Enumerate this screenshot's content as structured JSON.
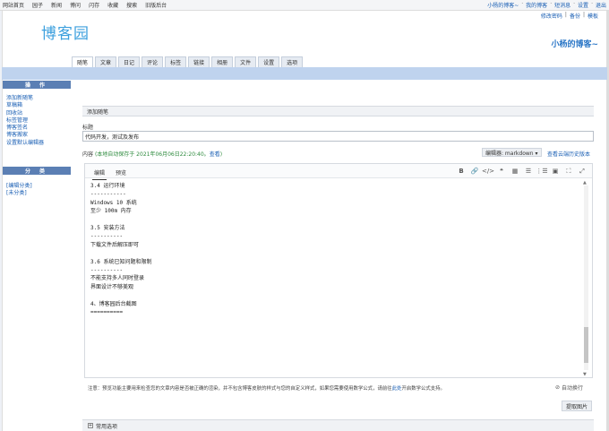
{
  "topnav": {
    "links": [
      "网站首页",
      "园子",
      "新闻",
      "博问",
      "闪存",
      "收藏",
      "搜索",
      "旧版后台"
    ],
    "user": "小杨的博客~",
    "my_blog": "我的博客",
    "messages": "短消息",
    "settings": "设置",
    "logout": "退出"
  },
  "header": {
    "logo": "博客园",
    "change_password": "修改密码",
    "backup": "备份",
    "template": "模板",
    "blog_title": "小杨的博客~"
  },
  "tabs": [
    "随笔",
    "文章",
    "日记",
    "评论",
    "标签",
    "链接",
    "相册",
    "文件",
    "设置",
    "选项"
  ],
  "sidebar": {
    "ops_title": "操 作",
    "ops_items": [
      "添加新随笔",
      "草稿箱",
      "回收站",
      "标签管理",
      "博客签名",
      "博客搬家",
      "设置默认编辑器"
    ],
    "cat_title": "分 类",
    "cat_items": [
      "[编辑分类]",
      "[未分类]"
    ]
  },
  "form": {
    "section_title": "添加随笔",
    "title_label": "标题",
    "title_value": "代码开发，测试及发布",
    "content_label": "内容",
    "autosave_text": "(本地自动保存于 2021年06月06日22:20:40。",
    "autosave_view": "查看",
    "autosave_end": ")",
    "editor_select": "编辑器: markdown ▾",
    "view_history": "查看云端历史版本"
  },
  "editor": {
    "tab_edit": "编辑",
    "tab_preview": "预览",
    "toolbar_icons": [
      "B",
      "🔗",
      "</>",
      "❝",
      "▦",
      "☰",
      "⋮☰",
      "▣",
      "⛶",
      "⤢"
    ],
    "content": "3.4 运行环境\n-----------\nWindows 10 系统\n至少 100m 内存\n\n3.5 安装方法\n----------\n下载文件后解压即可\n\n3.6 系统已知问题和限制\n----------\n不能支持多人同时登录\n界面设计不够美观\n\n4、博客园后台截图\n=========="
  },
  "footer": {
    "note_prefix": "注意：预览功能主要用来检查您的文章内容是否被正确的渲染，并不包含博客皮肤的样式与您的自定义样式，如果您需要使用数学公式，请前往",
    "note_link": "此处",
    "note_suffix": "开启数学公式支持。",
    "wrap_toggle": "自动换行",
    "extract_images": "提取图片",
    "common_options": "常用选项"
  }
}
